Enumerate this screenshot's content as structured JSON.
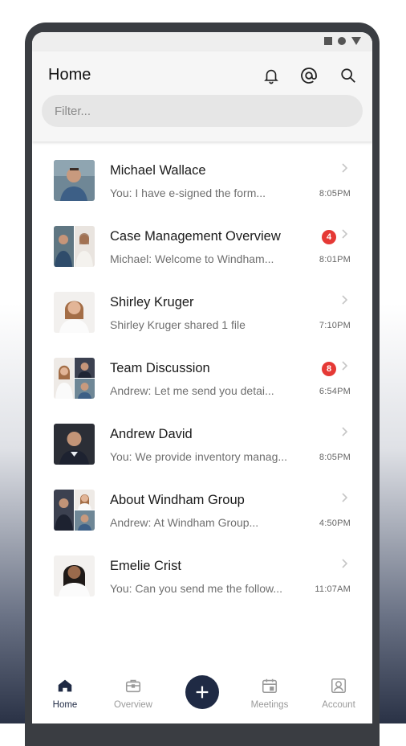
{
  "status_bar": {
    "icons": [
      "square-icon",
      "circle-icon",
      "triangle-icon"
    ]
  },
  "header": {
    "title": "Home",
    "icons": [
      "bell-icon",
      "at-icon",
      "search-icon"
    ]
  },
  "filter": {
    "placeholder": "Filter..."
  },
  "conversations": [
    {
      "name": "Michael Wallace",
      "preview": "You: I have e-signed the form...",
      "time": "8:05PM",
      "badge": null,
      "avatar": "single"
    },
    {
      "name": "Case Management Overview",
      "preview": "Michael:  Welcome to Windham...",
      "time": "8:01PM",
      "badge": "4",
      "avatar": "pair"
    },
    {
      "name": "Shirley Kruger",
      "preview": "Shirley Kruger shared 1 file",
      "time": "7:10PM",
      "badge": null,
      "avatar": "single"
    },
    {
      "name": "Team Discussion",
      "preview": "Andrew:  Let me send you detai...",
      "time": "6:54PM",
      "badge": "8",
      "avatar": "triple"
    },
    {
      "name": "Andrew David",
      "preview": "You: We provide inventory manag...",
      "time": "8:05PM",
      "badge": null,
      "avatar": "single"
    },
    {
      "name": "About Windham Group",
      "preview": "Andrew:  At Windham Group...",
      "time": "4:50PM",
      "badge": null,
      "avatar": "triple"
    },
    {
      "name": "Emelie Crist",
      "preview": "You:  Can you send me the follow...",
      "time": "11:07AM",
      "badge": null,
      "avatar": "single"
    }
  ],
  "bottom_nav": {
    "items": [
      {
        "label": "Home",
        "icon": "home-icon",
        "active": true
      },
      {
        "label": "Overview",
        "icon": "briefcase-icon",
        "active": false
      },
      {
        "label": "",
        "icon": "plus-icon",
        "active": false
      },
      {
        "label": "Meetings",
        "icon": "calendar-icon",
        "active": false
      },
      {
        "label": "Account",
        "icon": "account-icon",
        "active": false
      }
    ]
  },
  "colors": {
    "accent": "#1f2a44",
    "badge": "#e53935",
    "muted_text": "#6f6f6f"
  }
}
